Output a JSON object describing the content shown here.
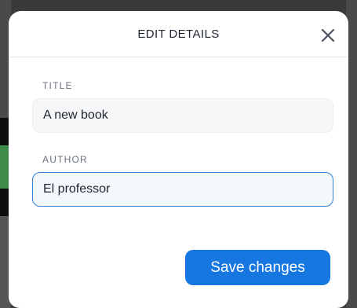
{
  "dialog": {
    "title": "EDIT DETAILS",
    "close_icon": "close-icon"
  },
  "fields": {
    "title": {
      "label": "TITLE",
      "value": "A new book"
    },
    "author": {
      "label": "AUTHOR",
      "value": "El professor"
    }
  },
  "actions": {
    "save_label": "Save changes"
  },
  "colors": {
    "accent": "#1677e0",
    "focus_border": "#2f80d6",
    "text": "#1f2430",
    "label": "#6b7280"
  }
}
